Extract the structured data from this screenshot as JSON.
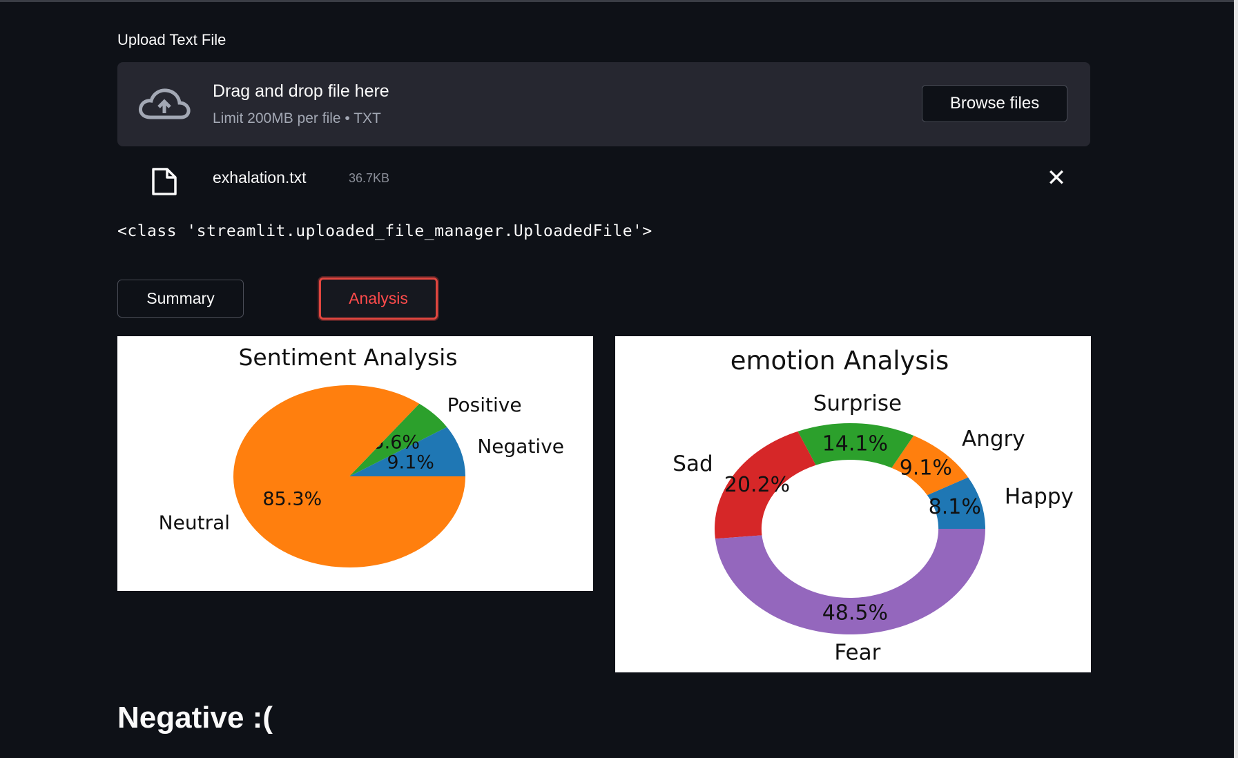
{
  "uploader": {
    "label": "Upload Text File",
    "drop_text": "Drag and drop file here",
    "limit_text": "Limit 200MB per file • TXT",
    "browse_label": "Browse files"
  },
  "file": {
    "name": "exhalation.txt",
    "size": "36.7KB",
    "remove_icon": "✕"
  },
  "class_output": "<class 'streamlit.uploaded_file_manager.UploadedFile'>",
  "buttons": {
    "summary": "Summary",
    "analysis": "Analysis"
  },
  "result_heading": "Negative :(",
  "colors": {
    "accent": "#ff4b4b",
    "background": "#0e1117",
    "dropzone": "#262730"
  },
  "chart_data": [
    {
      "type": "pie",
      "title": "Sentiment Analysis",
      "slices": [
        {
          "label": "Negative",
          "value": 9.1,
          "pct_label": "9.1%",
          "color": "#1f77b4"
        },
        {
          "label": "Positive",
          "value": 5.6,
          "pct_label": "5.6%",
          "color": "#2ca02c"
        },
        {
          "label": "Neutral",
          "value": 85.3,
          "pct_label": "85.3%",
          "color": "#ff7f0e"
        }
      ]
    },
    {
      "type": "pie",
      "title": "emotion Analysis",
      "donut": true,
      "slices": [
        {
          "label": "Happy",
          "value": 8.1,
          "pct_label": "8.1%",
          "color": "#1f77b4"
        },
        {
          "label": "Angry",
          "value": 9.1,
          "pct_label": "9.1%",
          "color": "#ff7f0e"
        },
        {
          "label": "Surprise",
          "value": 14.1,
          "pct_label": "14.1%",
          "color": "#2ca02c"
        },
        {
          "label": "Sad",
          "value": 20.2,
          "pct_label": "20.2%",
          "color": "#d62728"
        },
        {
          "label": "Fear",
          "value": 48.5,
          "pct_label": "48.5%",
          "color": "#9467bd"
        }
      ]
    }
  ]
}
